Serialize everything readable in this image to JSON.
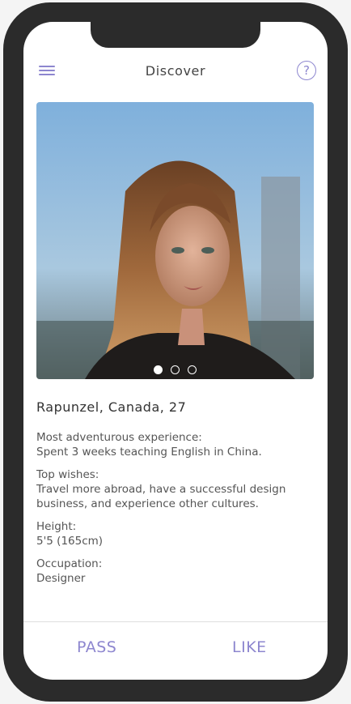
{
  "header": {
    "title": "Discover",
    "menu_icon": "hamburger-menu-icon",
    "help_icon": "question-mark-icon",
    "help_glyph": "?"
  },
  "profile": {
    "name_line": "Rapunzel, Canada, 27",
    "photo_count": 3,
    "active_photo": 1,
    "details": [
      {
        "label": "Most adventurous experience:",
        "value": "Spent 3 weeks teaching English in China."
      },
      {
        "label": "Top wishes:",
        "value": "Travel more abroad, have a successful design business, and experience other cultures."
      },
      {
        "label": "Height:",
        "value": "5'5 (165cm)"
      },
      {
        "label": "Occupation:",
        "value": "Designer"
      }
    ]
  },
  "actions": {
    "pass_label": "PASS",
    "like_label": "LIKE"
  },
  "colors": {
    "accent": "#8d86cf",
    "frame": "#2b2b2b"
  }
}
